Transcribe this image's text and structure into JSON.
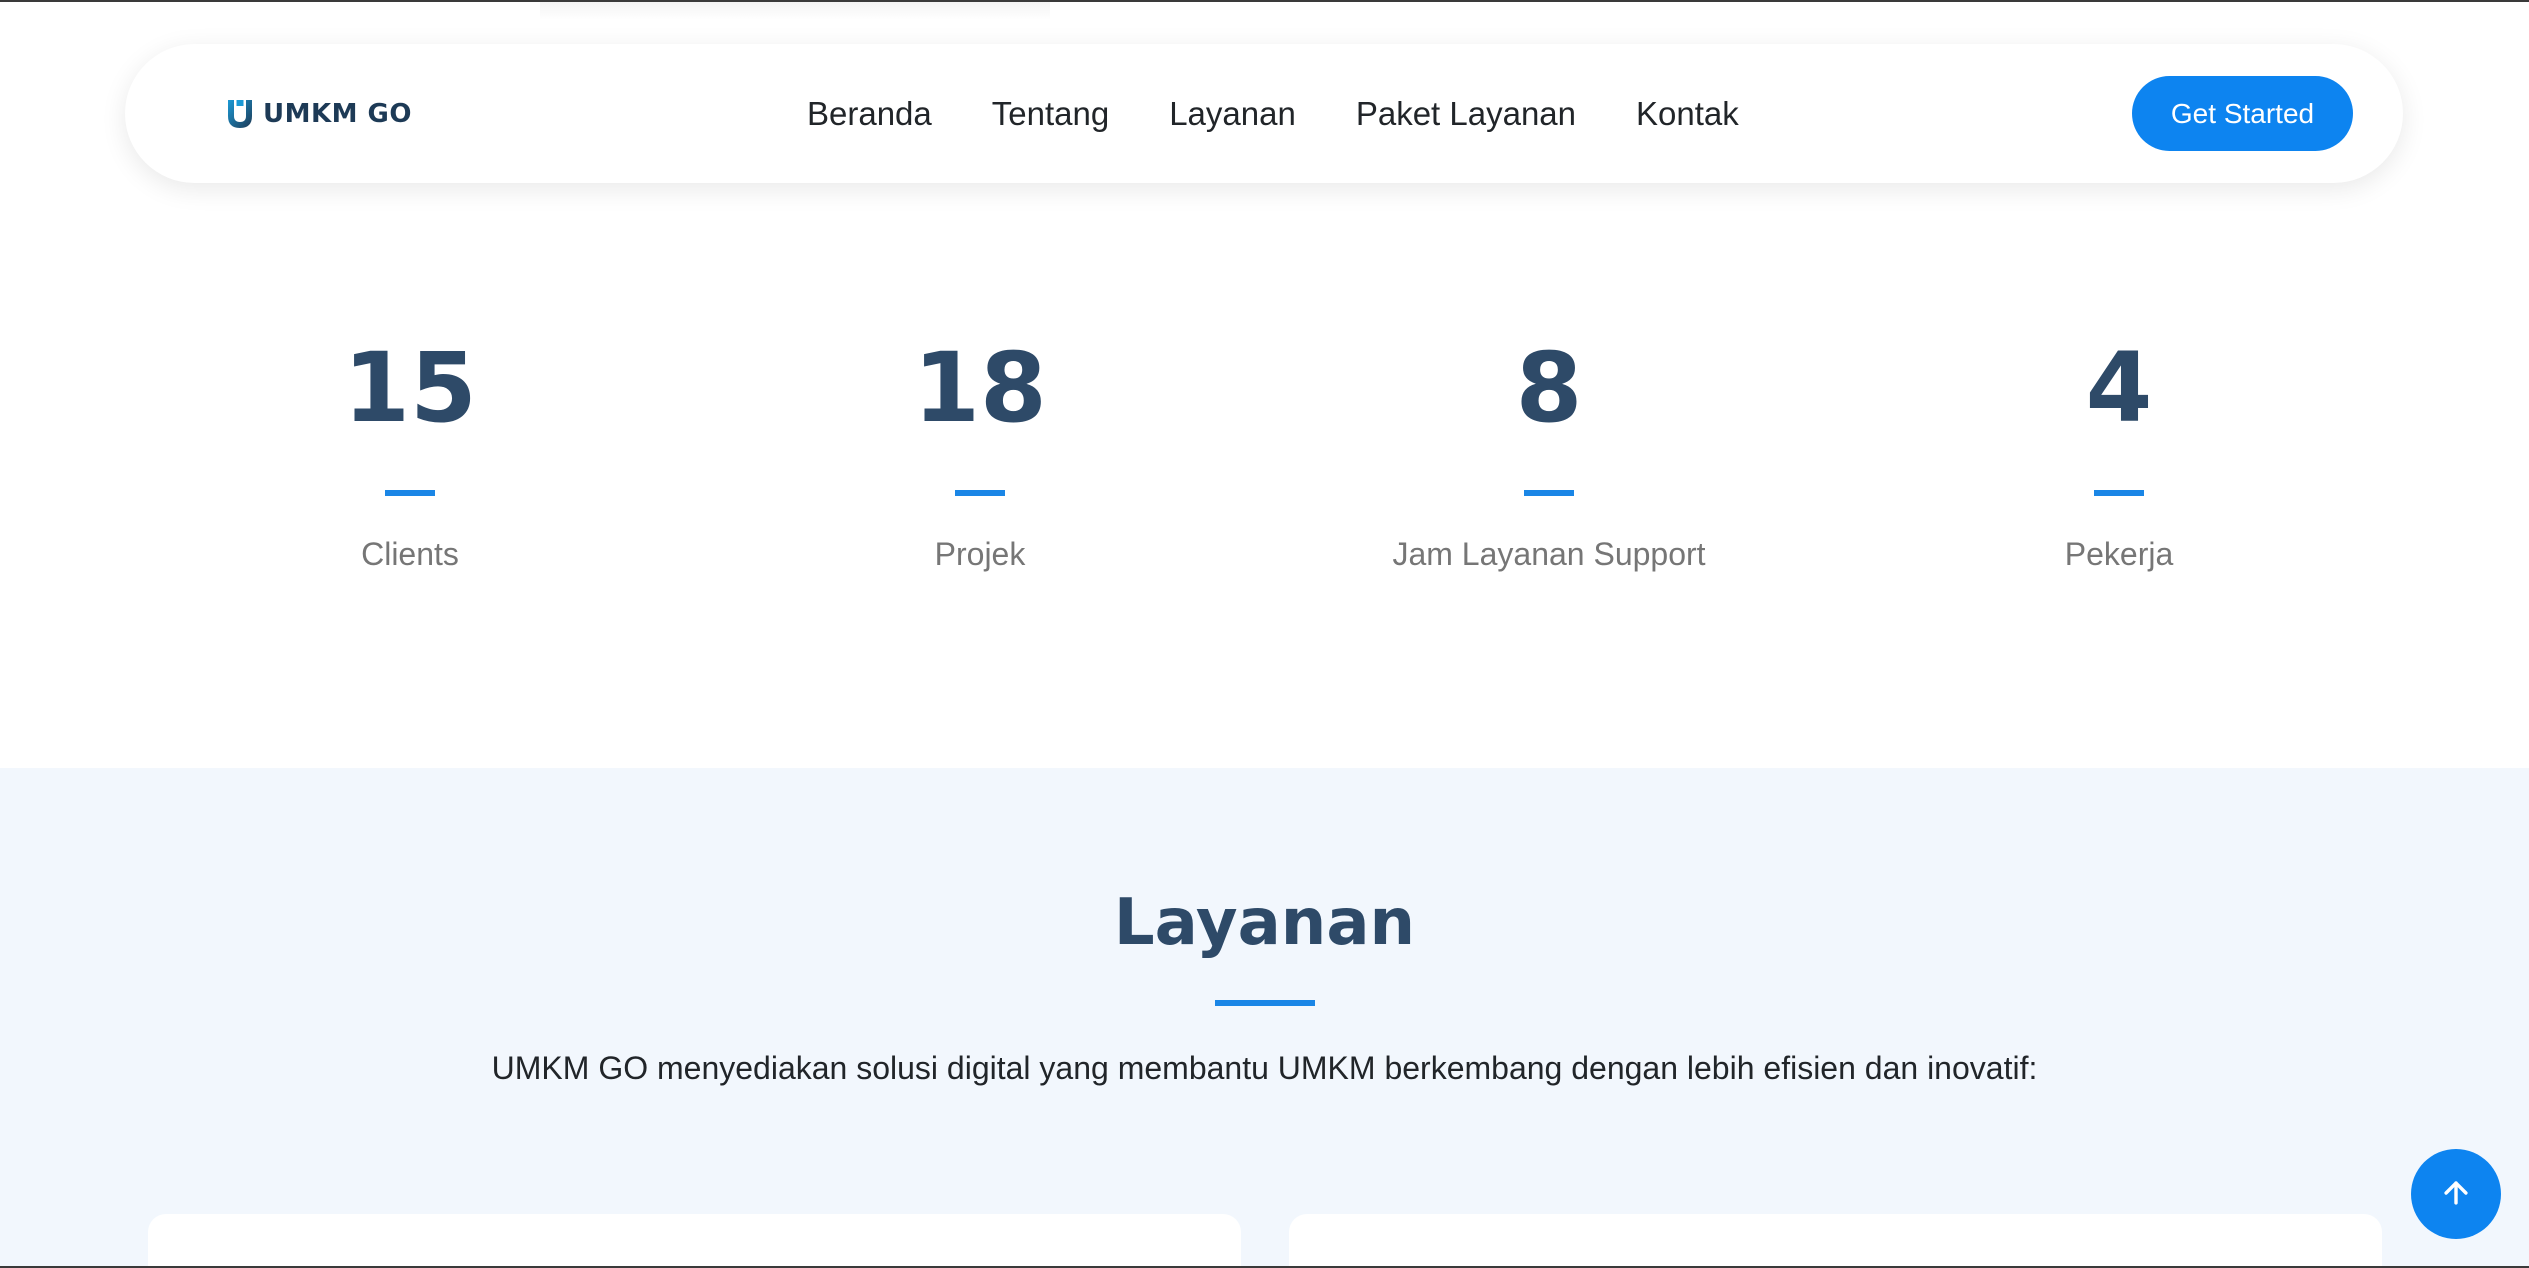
{
  "header": {
    "logo_text": "UMKM GO",
    "nav": [
      "Beranda",
      "Tentang",
      "Layanan",
      "Paket Layanan",
      "Kontak"
    ],
    "cta_label": "Get Started"
  },
  "stats": [
    {
      "number": "15",
      "label": "Clients"
    },
    {
      "number": "18",
      "label": "Projek"
    },
    {
      "number": "8",
      "label": "Jam Layanan Support"
    },
    {
      "number": "4",
      "label": "Pekerja"
    }
  ],
  "services": {
    "title": "Layanan",
    "description": "UMKM GO menyediakan solusi digital yang membantu UMKM berkembang dengan lebih efisien dan inovatif:"
  },
  "icons": {
    "logo": "u-logo-icon",
    "scroll_top": "arrow-up-icon"
  },
  "colors": {
    "accent": "#0d84f0",
    "heading": "#2e4a68",
    "section_bg": "#f2f7fd"
  }
}
